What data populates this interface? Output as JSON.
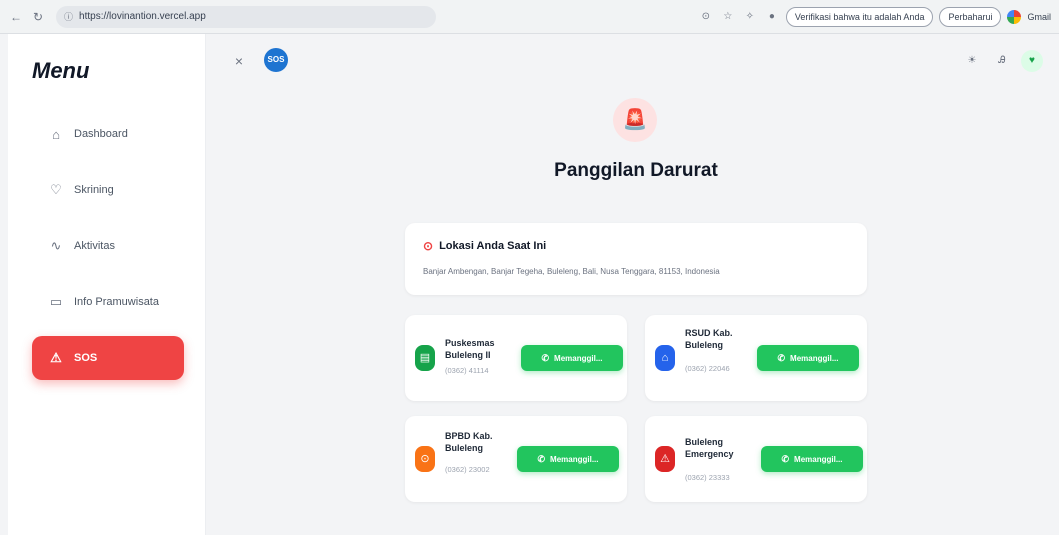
{
  "browser": {
    "url": "https://lovinantion.vercel.app",
    "pill_1": "Verifikasi bahwa itu adalah Anda",
    "pill_2": "Perbaharui",
    "profile_label": "Gmail"
  },
  "sidebar": {
    "title": "Menu",
    "items": [
      {
        "label": "Dashboard",
        "icon": "home-icon"
      },
      {
        "label": "Skrining",
        "icon": "lightbulb-icon"
      },
      {
        "label": "Aktivitas",
        "icon": "activity-icon"
      },
      {
        "label": "Info Pramuwisata",
        "icon": "monitor-icon"
      },
      {
        "label": "SOS",
        "icon": "alarm-icon",
        "active": true
      }
    ]
  },
  "topbar": {
    "badge": "SOS"
  },
  "page": {
    "title": "Panggilan Darurat"
  },
  "location": {
    "title": "Lokasi Anda Saat Ini",
    "address": "Banjar Ambengan, Banjar Tegeha, Buleleng, Bali, Nusa Tenggara, 81153, Indonesia"
  },
  "services": [
    {
      "name": "Puskesmas Buleleng II",
      "phone": "(0362) 41114",
      "button": "Memanggil...",
      "color": "#16a34a",
      "icon": "clinic-icon"
    },
    {
      "name": "RSUD Kab. Buleleng",
      "phone": "(0362) 22046",
      "button": "Memanggil...",
      "color": "#2563eb",
      "icon": "hospital-icon"
    },
    {
      "name": "BPBD Kab. Buleleng",
      "phone": "(0362) 23002",
      "button": "Memanggil...",
      "color": "#f97316",
      "icon": "warning-icon"
    },
    {
      "name": "Buleleng Emergency",
      "phone": "(0362) 23333",
      "button": "Memanggil...",
      "color": "#dc2626",
      "icon": "siren-icon"
    }
  ],
  "colors": {
    "accent_red": "#ef4444",
    "call_green": "#22c55e",
    "badge_blue": "#1e74d1"
  }
}
